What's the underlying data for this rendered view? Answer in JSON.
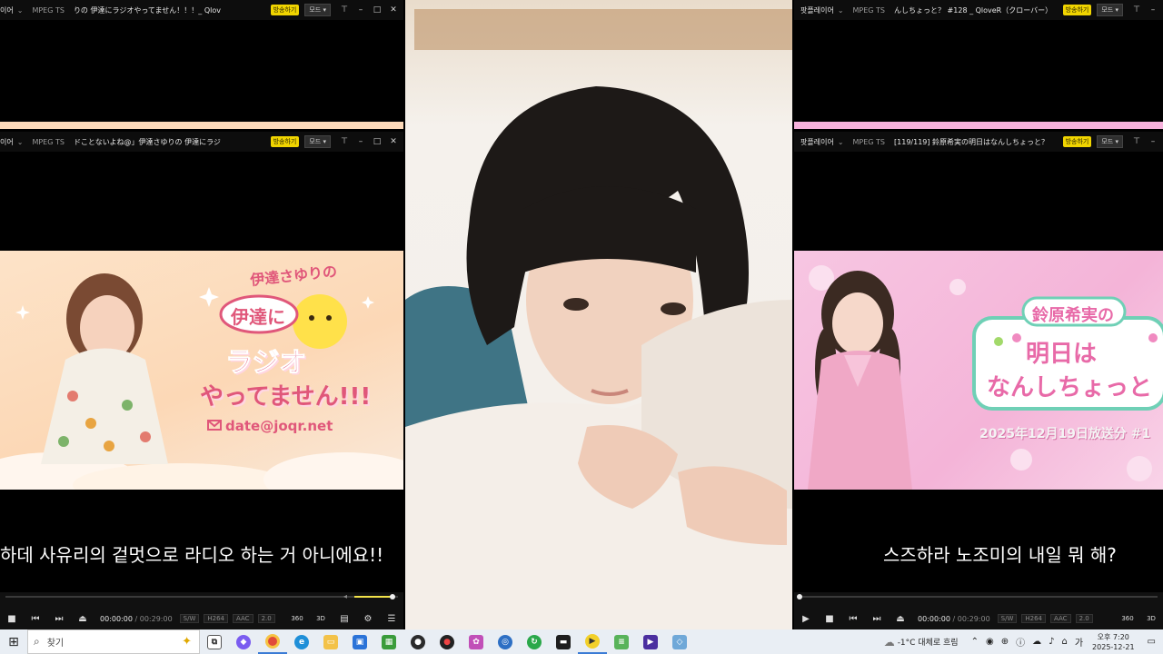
{
  "left_top_player": {
    "app": "이어",
    "format": "MPEG TS",
    "title": "りの 伊達にラジオやってません！！！_ Qlov",
    "broadcast_btn": "방송하기",
    "mode_btn": "모드"
  },
  "left_main_player": {
    "app": "이어",
    "format": "MPEG TS",
    "title": "ドことないよね@」伊達さゆりの 伊達にラジ",
    "broadcast_btn": "방송하기",
    "mode_btn": "모드",
    "subtitle": "하데 사유리의 겉멋으로 라디오 하는 거 아니에요!!",
    "banner": {
      "line1": "伊達さゆりの",
      "line2": "伊達に",
      "line3": "ラジオ",
      "line4": "やってません!!!",
      "email": "date@joqr.net"
    },
    "controls": {
      "time": "00:00:00",
      "total": "/ 00:29:00",
      "tags": [
        "S/W",
        "H264",
        "AAC",
        "2.0"
      ],
      "view_tags": [
        "360",
        "3D"
      ]
    }
  },
  "right_top_player": {
    "app": "팟플레이어",
    "format": "MPEG TS",
    "title": "んしちょっと？ #128 _ QloveR（クローバー）",
    "broadcast_btn": "방송하기",
    "mode_btn": "모드"
  },
  "right_main_player": {
    "app": "팟플레이어",
    "format": "MPEG TS",
    "title": "[119/119] 鈴原希実の明日はなんしちょっと？",
    "broadcast_btn": "방송하기",
    "mode_btn": "모드",
    "subtitle": "스즈하라 노조미의 내일 뭐 해?",
    "banner": {
      "line1": "鈴原希実の",
      "line2": "明日は",
      "line3": "なんしちょっと",
      "date": "2025年12月19日放送分 #1"
    },
    "controls": {
      "time": "00:00:00",
      "total": "/ 00:29:00",
      "tags": [
        "S/W",
        "H264",
        "AAC",
        "2.0"
      ],
      "view_tags": [
        "360",
        "3D"
      ]
    }
  },
  "taskbar": {
    "search_placeholder": "찾기",
    "weather": "-1°C 대체로 흐림",
    "time": "오후 7:20",
    "date": "2025-12-21"
  }
}
